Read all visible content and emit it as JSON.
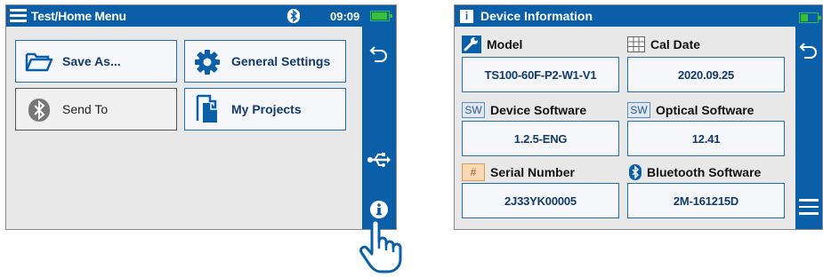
{
  "left_screen": {
    "title": "Test/Home Menu",
    "time": "09:09",
    "buttons": {
      "save_as": "Save As...",
      "general_settings": "General Settings",
      "send_to": "Send To",
      "my_projects": "My Projects"
    },
    "icons": {
      "menu": "hamburger-menu-icon",
      "bluetooth": "bluetooth-icon",
      "battery": "battery-icon",
      "back": "back-arrow-icon",
      "usb": "usb-icon",
      "info": "info-icon",
      "pointer": "pointing-hand-icon"
    }
  },
  "right_screen": {
    "title": "Device Information",
    "fields": {
      "model": {
        "label": "Model",
        "value": "TS100-60F-P2-W1-V1"
      },
      "cal_date": {
        "label": "Cal Date",
        "value": "2020.09.25"
      },
      "device_software": {
        "label": "Device Software",
        "badge": "SW",
        "value": "1.2.5-ENG"
      },
      "optical_software": {
        "label": "Optical Software",
        "badge": "SW",
        "value": "12.41"
      },
      "serial_number": {
        "label": "Serial Number",
        "badge": "#",
        "value": "2J33YK00005"
      },
      "bluetooth_software": {
        "label": "Bluetooth Software",
        "value": "2M-161215D"
      }
    },
    "info_badge": "i"
  },
  "colors": {
    "titlebar_blue": "#0a5fa8",
    "button_border": "#1c6fb4",
    "battery_green": "#39c03a",
    "panel_gray": "#e8e8e8"
  }
}
